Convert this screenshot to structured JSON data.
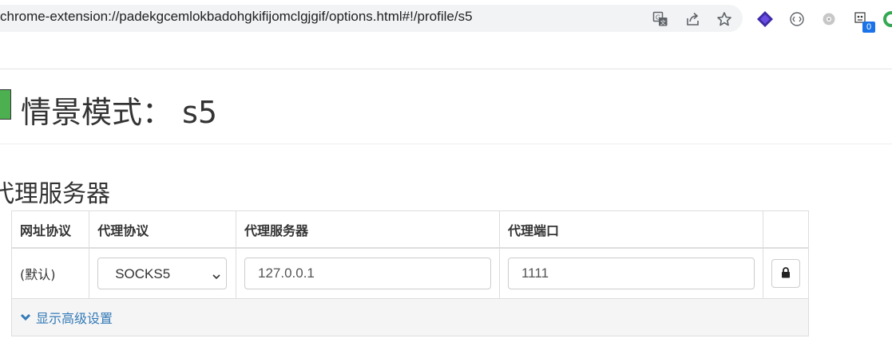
{
  "browser": {
    "url": "chrome-extension://padekgcemlokbadohgkifijomclgjgif/options.html#!/profile/s5",
    "extension_badge": "0",
    "icons": [
      "translate-icon",
      "share-icon",
      "bookmark-star-icon",
      "extension-purple-icon",
      "extension-circle-icon",
      "extension-gear-icon",
      "extension-avatar-icon",
      "extension-green-icon"
    ]
  },
  "header": {
    "title": "情景模式： s5",
    "profile_color": "#4caf50"
  },
  "proxy_section": {
    "title": "代理服务器",
    "columns": [
      "网址协议",
      "代理协议",
      "代理服务器",
      "代理端口"
    ],
    "rows": [
      {
        "scheme": "(默认)",
        "protocol": "SOCKS5",
        "server": "127.0.0.1",
        "port": "1111"
      }
    ],
    "advanced_link": "显示高级设置",
    "link_color": "#337ab7"
  }
}
